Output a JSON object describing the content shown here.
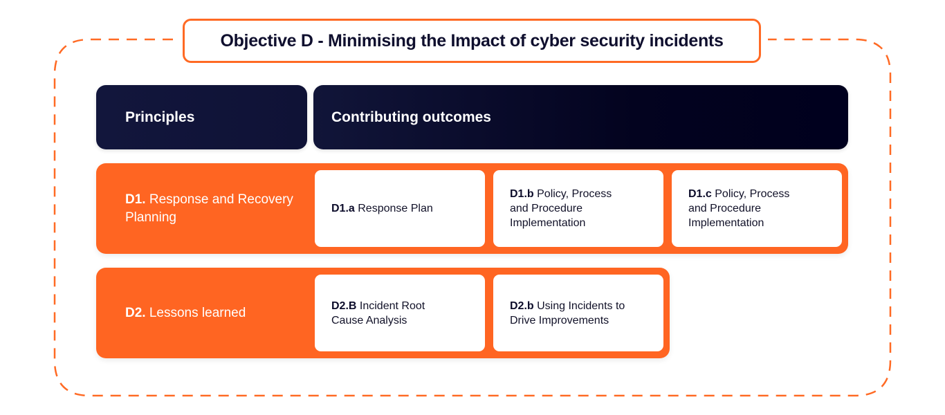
{
  "title": "Objective D - Minimising the Impact of cyber security incidents",
  "headers": {
    "principles": "Principles",
    "outcomes": "Contributing outcomes"
  },
  "colors": {
    "accent_orange": "#ff6522",
    "header_navy": "#12163c",
    "header_dark": "#00001e",
    "card_bg": "#ffffff"
  },
  "rows": [
    {
      "principle_code": "D1.",
      "principle_label": "Response and Recovery Planning",
      "outcomes": [
        {
          "code": "D1.a",
          "label": "Response Plan"
        },
        {
          "code": "D1.b",
          "label": "Policy, Process and Procedure Implementation"
        },
        {
          "code": "D1.c",
          "label": "Policy, Process and Procedure Implementation"
        }
      ]
    },
    {
      "principle_code": "D2.",
      "principle_label": "Lessons learned",
      "outcomes": [
        {
          "code": "D2.B",
          "label": "Incident Root Cause Analysis"
        },
        {
          "code": "D2.b",
          "label": "Using Incidents to Drive Improvements"
        }
      ]
    }
  ]
}
